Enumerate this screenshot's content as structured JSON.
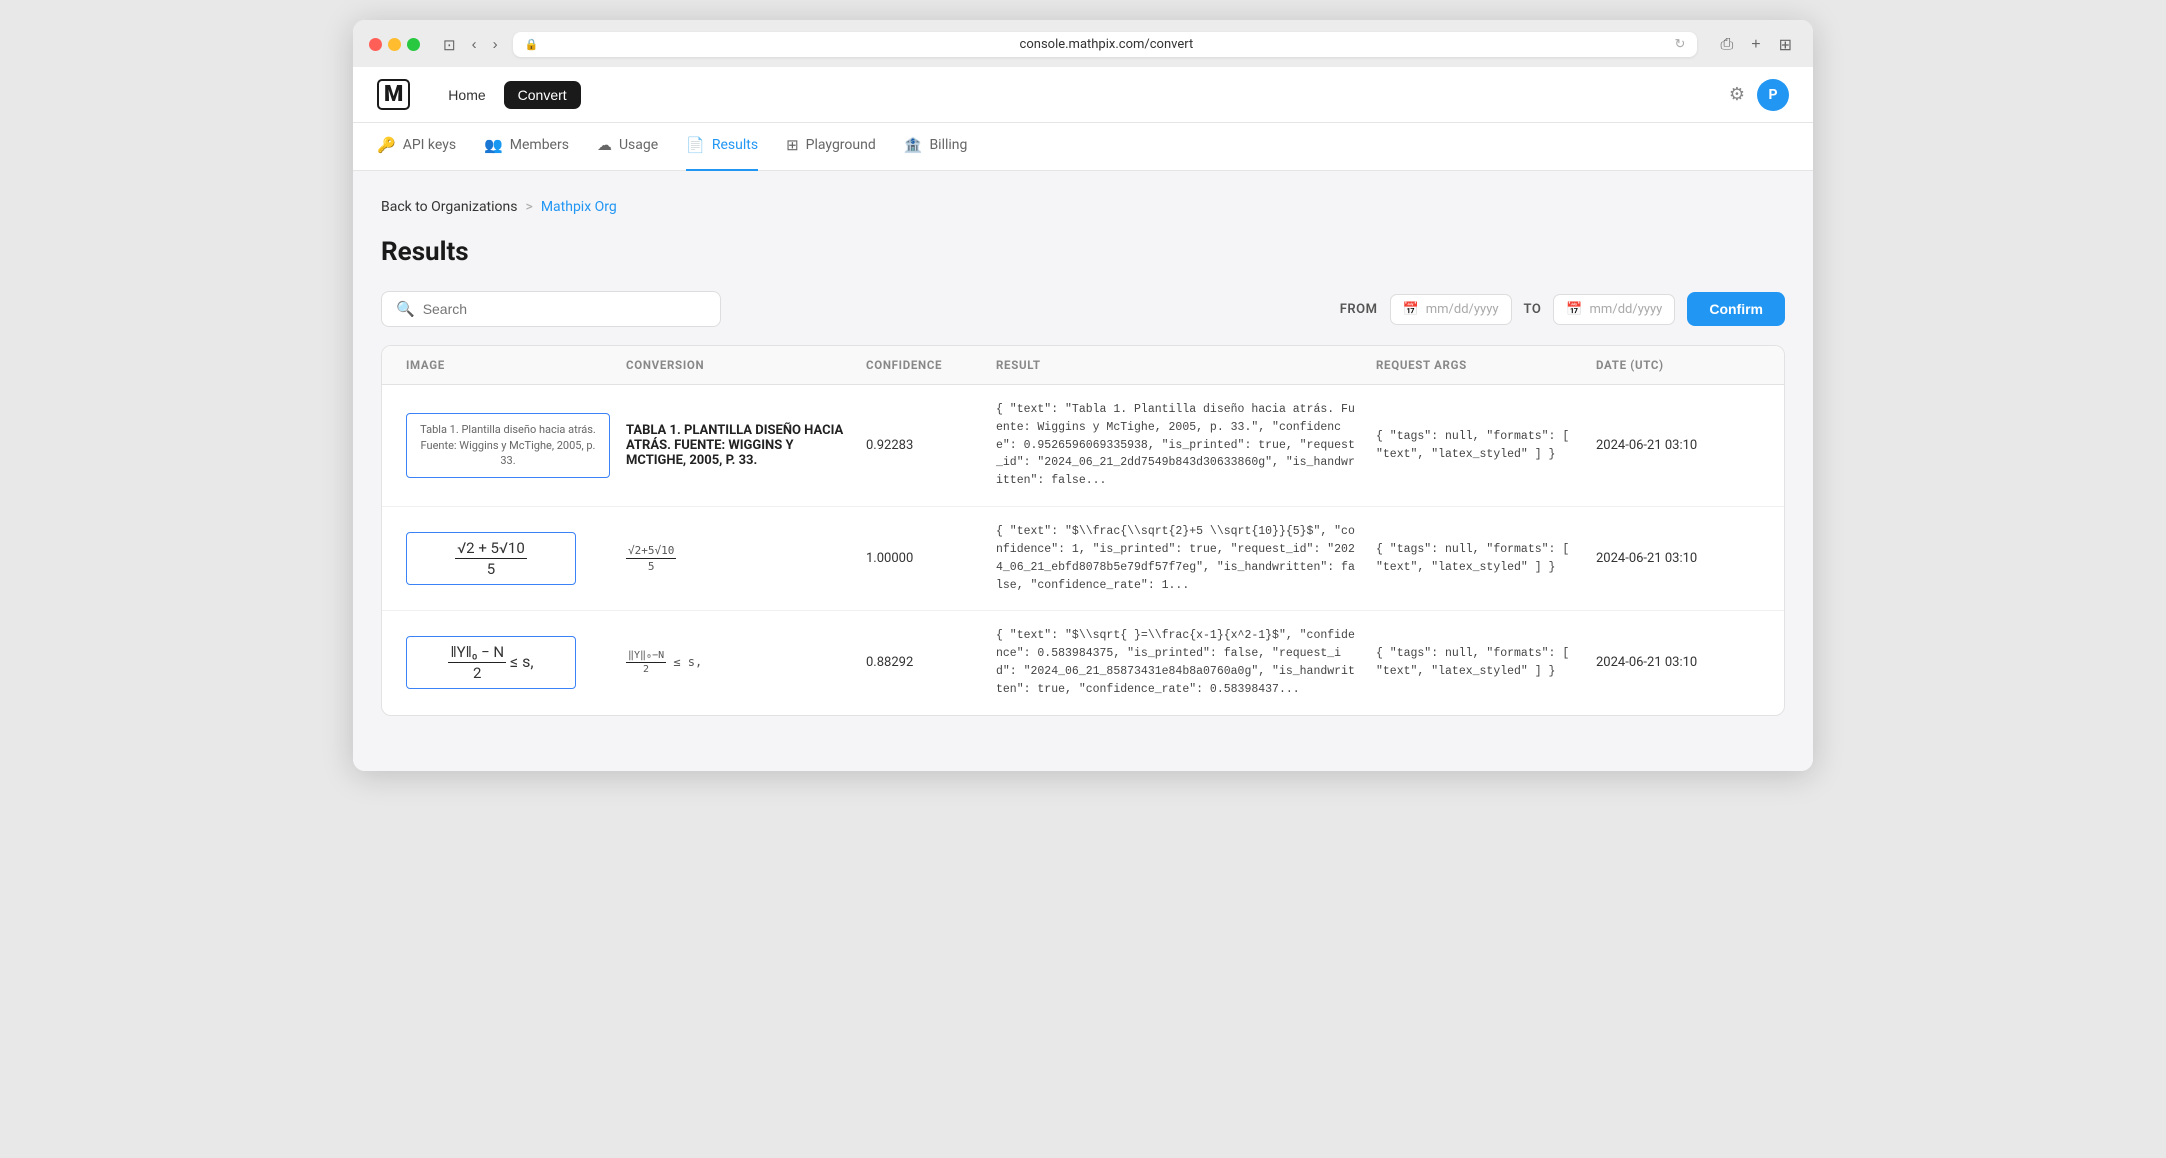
{
  "browser": {
    "url": "console.mathpix.com/convert",
    "back_label": "‹",
    "forward_label": "›"
  },
  "app": {
    "logo": "M",
    "nav": [
      {
        "label": "Home",
        "active": false
      },
      {
        "label": "Convert",
        "active": true
      }
    ],
    "avatar_label": "P"
  },
  "sub_nav": [
    {
      "label": "API keys",
      "icon": "🔑",
      "active": false
    },
    {
      "label": "Members",
      "icon": "👥",
      "active": false
    },
    {
      "label": "Usage",
      "icon": "☁",
      "active": false
    },
    {
      "label": "Results",
      "icon": "📄",
      "active": true
    },
    {
      "label": "Playground",
      "icon": "⊞",
      "active": false
    },
    {
      "label": "Billing",
      "icon": "🏦",
      "active": false
    }
  ],
  "breadcrumb": {
    "back_label": "Back to Organizations",
    "separator": ">",
    "current": "Mathpix Org"
  },
  "page": {
    "title": "Results"
  },
  "toolbar": {
    "search_placeholder": "Search",
    "from_label": "FROM",
    "to_label": "TO",
    "date_placeholder": "mm/dd/yyyy",
    "confirm_label": "Confirm"
  },
  "table": {
    "headers": [
      "IMAGE",
      "CONVERSION",
      "CONFIDENCE",
      "RESULT",
      "REQUEST ARGS",
      "DATE (UTC)"
    ],
    "rows": [
      {
        "image_type": "text_box",
        "image_text": "Tabla 1. Plantilla diseño hacia atrás. Fuente: Wiggins y McTighe, 2005, p. 33.",
        "conversion": "TABLA 1. PLANTILLA DISEÑO HACIA ATRÁS. FUENTE: WIGGINS Y MCTIGHE, 2005, P. 33.",
        "confidence": "0.92283",
        "result": "{ \"text\": \"Tabla 1. Plantilla diseño hacia atrás. Fuente: Wiggins y McTighe, 2005, p. 33.\", \"confidence\": 0.9526596069335938, \"is_printed\": true, \"request_id\": \"2024_06_21_2dd7549b843d30633860g\", \"is_handwritten\": false...",
        "request_args": "{ \"tags\": null, \"formats\": [ \"text\", \"latex_styled\" ] }",
        "date": "2024-06-21 03:10"
      },
      {
        "image_type": "math_frac",
        "image_text": "",
        "conversion": "√2+5√10 / 5",
        "conversion_math": true,
        "confidence": "1.00000",
        "result": "{ \"text\": \"$\\\\frac{\\\\sqrt{2}+5 \\\\sqrt{10}}{5}$\", \"confidence\": 1, \"is_printed\": true, \"request_id\": \"2024_06_21_ebfd8078b5e79df57f7eg\", \"is_handwritten\": false, \"confidence_rate\": 1...",
        "request_args": "{ \"tags\": null, \"formats\": [ \"text\", \"latex_styled\" ] }",
        "date": "2024-06-21 03:10"
      },
      {
        "image_type": "math_norm",
        "image_text": "",
        "conversion": "∥Y∥₀−N / 2 ≤ s,",
        "conversion_math": true,
        "confidence": "0.88292",
        "result": "{ \"text\": \"$\\\\sqrt{ }=\\\\frac{x-1}{x^2-1}$\", \"confidence\": 0.583984375, \"is_printed\": false, \"request_id\": \"2024_06_21_85873431e84b8a0760a0g\", \"is_handwritten\": true, \"confidence_rate\": 0.58398437...",
        "request_args": "{ \"tags\": null, \"formats\": [ \"text\", \"latex_styled\" ] }",
        "date": "2024-06-21 03:10"
      }
    ]
  }
}
